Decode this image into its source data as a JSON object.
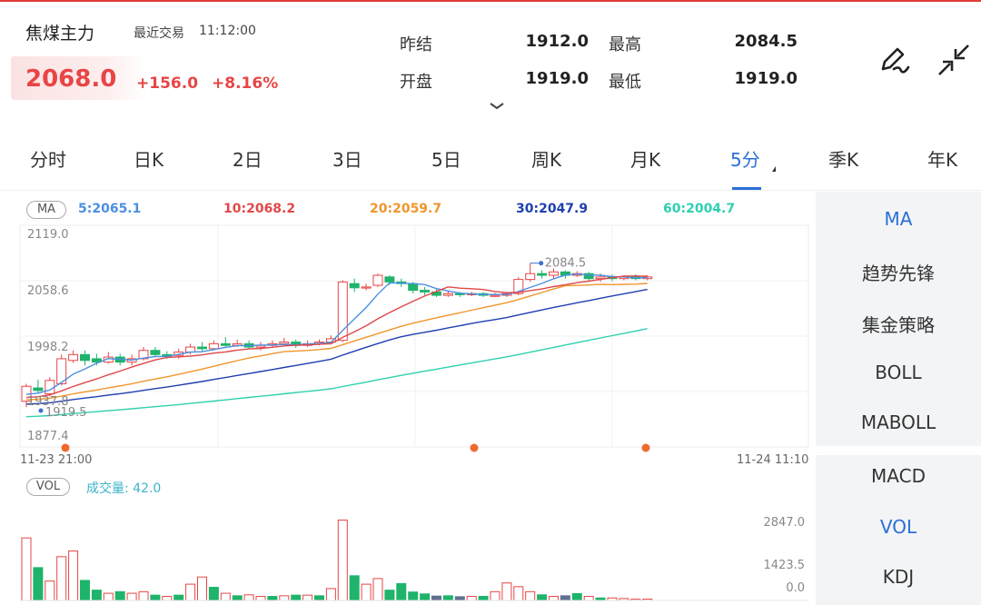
{
  "instrument": {
    "name": "焦煤主力",
    "trade_label": "最近交易",
    "trade_time": "11:12:00",
    "price": "2068.0",
    "change": "+156.0",
    "change_pct": "+8.16%"
  },
  "stats": {
    "prev_settle_label": "昨结",
    "prev_settle": "1912.0",
    "high_label": "最高",
    "high": "2084.5",
    "open_label": "开盘",
    "open": "1919.0",
    "low_label": "最低",
    "low": "1919.0"
  },
  "tabs": [
    {
      "label": "分时"
    },
    {
      "label": "日K"
    },
    {
      "label": "2日"
    },
    {
      "label": "3日"
    },
    {
      "label": "5日"
    },
    {
      "label": "周K"
    },
    {
      "label": "月K"
    },
    {
      "label": "5分"
    },
    {
      "label": "季K"
    },
    {
      "label": "年K"
    }
  ],
  "active_tab": "5分",
  "ma_bar": {
    "badge": "MA",
    "ma5": "5:2065.1",
    "ma10": "10:2068.2",
    "ma20": "20:2059.7",
    "ma30": "30:2047.9",
    "ma60": "60:2004.7"
  },
  "colors": {
    "up": "#e84545",
    "down": "#1fb36b",
    "ma5": "#4a90e2",
    "ma10": "#e04848",
    "ma20": "#f0962c",
    "ma30": "#1f3fb0",
    "ma60": "#2fd0b0",
    "accent": "#2a6fd6"
  },
  "price_axis": {
    "ticks": [
      "2119.0",
      "2058.6",
      "1998.2",
      "1877.4"
    ],
    "high_marker": "2084.5",
    "low_marker_1": "1937.8",
    "low_marker_2": "1919.5"
  },
  "time_axis": {
    "start": "11-23 21:00",
    "end": "11-24 11:10"
  },
  "vol_bar": {
    "badge": "VOL",
    "value": "成交量: 42.0",
    "ticks": [
      "2847.0",
      "1423.5",
      "0.0"
    ]
  },
  "side_panel": {
    "items": [
      "MA",
      "趋势先锋",
      "集金策略",
      "BOLL",
      "MABOLL"
    ],
    "sub_items": [
      "MACD",
      "VOL",
      "KDJ"
    ],
    "active_main": "MA",
    "active_sub": "VOL"
  },
  "icons": [
    "pen-icon",
    "collapse-arrows-icon",
    "chevron-down-icon"
  ]
}
